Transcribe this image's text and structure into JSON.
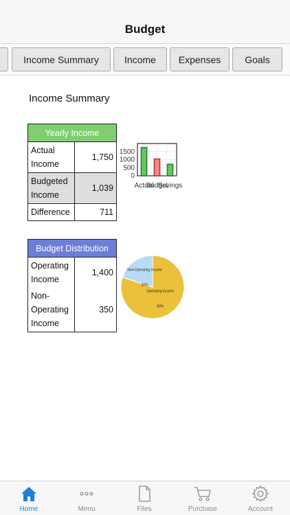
{
  "header": {
    "title": "Budget"
  },
  "tabs": [
    {
      "label": "Income Summary"
    },
    {
      "label": "Income"
    },
    {
      "label": "Expenses"
    },
    {
      "label": "Goals"
    }
  ],
  "page": {
    "section_title": "Income Summary"
  },
  "yearly_income": {
    "header": "Yearly Income",
    "rows": [
      {
        "label": "Actual Income",
        "value": "1,750"
      },
      {
        "label": "Budgeted Income",
        "value": "1,039"
      },
      {
        "label": "Difference",
        "value": "711"
      }
    ]
  },
  "budget_distribution": {
    "header": "Budget Distribution",
    "rows": [
      {
        "label": "Operating Income",
        "value": "1,400"
      },
      {
        "label": "Non-Operating Income",
        "value": "350"
      }
    ]
  },
  "chart_data": [
    {
      "type": "bar",
      "categories": [
        "Actual",
        "Budget",
        "Savings"
      ],
      "values": [
        1750,
        1039,
        711
      ],
      "colors": [
        "#6cc46a",
        "#f08c8c",
        "#6cc46a"
      ],
      "yticks": [
        "1500",
        "1000",
        "500",
        "0"
      ],
      "ylim": [
        0,
        2000
      ]
    },
    {
      "type": "pie",
      "slices": [
        {
          "name": "Operating Income",
          "value": 80,
          "label": "80%",
          "color": "#ebc13c"
        },
        {
          "name": "Non-Operating Income",
          "value": 20,
          "label": "20%",
          "color": "#b7dbf5"
        }
      ]
    }
  ],
  "bottom_tabs": [
    {
      "label": "Home",
      "icon": "home-icon",
      "active": true
    },
    {
      "label": "Menu",
      "icon": "more-dots-icon"
    },
    {
      "label": "Files",
      "icon": "file-icon"
    },
    {
      "label": "Purchase",
      "icon": "cart-icon"
    },
    {
      "label": "Account",
      "icon": "gear-icon"
    }
  ],
  "colors": {
    "accent": "#1e7fd8",
    "yearly_header": "#7fcf72",
    "distribution_header": "#6b7fd7"
  }
}
